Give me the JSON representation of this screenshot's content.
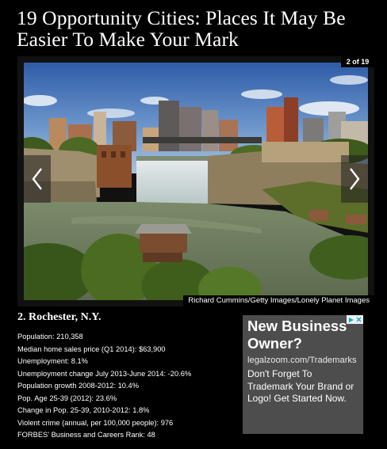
{
  "article": {
    "headline": "19 Opportunity Cities: Places It May Be Easier To Make Your Mark"
  },
  "slideshow": {
    "counter": "2 of 19",
    "photo_credit": "Richard Cummins/Getty Images/Lonely Planet Images",
    "prev_icon": "chevron-left-icon",
    "next_icon": "chevron-right-icon"
  },
  "city": {
    "title": "2. Rochester, N.Y.",
    "stats": [
      "Population: 210,358",
      "Median home sales price (Q1 2014): $63,900",
      "Unemployment: 8.1%",
      "Unemployment change July 2013-June 2014: -20.6%",
      "Population growth 2008-2012: 10.4%",
      "Pop. Age 25-39 (2012): 23.6%",
      "Change in Pop. 25-39, 2010-2012: 1.8%",
      "Violent crime (annual, per 100,000 people): 976",
      "FORBES' Business and Careers Rank: 48"
    ]
  },
  "ad": {
    "headline": "New Business Owner?",
    "url": "legalzoom.com/Trademarks",
    "body": "Don't Forget To Trademark Your Brand or Logo! Get Started Now.",
    "badge_icons": [
      "adchoices-icon",
      "close-icon"
    ]
  },
  "colors": {
    "page_background": "#000000",
    "ad_background": "#4d4d4d",
    "text": "#ffffff",
    "adchoices_blue": "#00aecd"
  }
}
